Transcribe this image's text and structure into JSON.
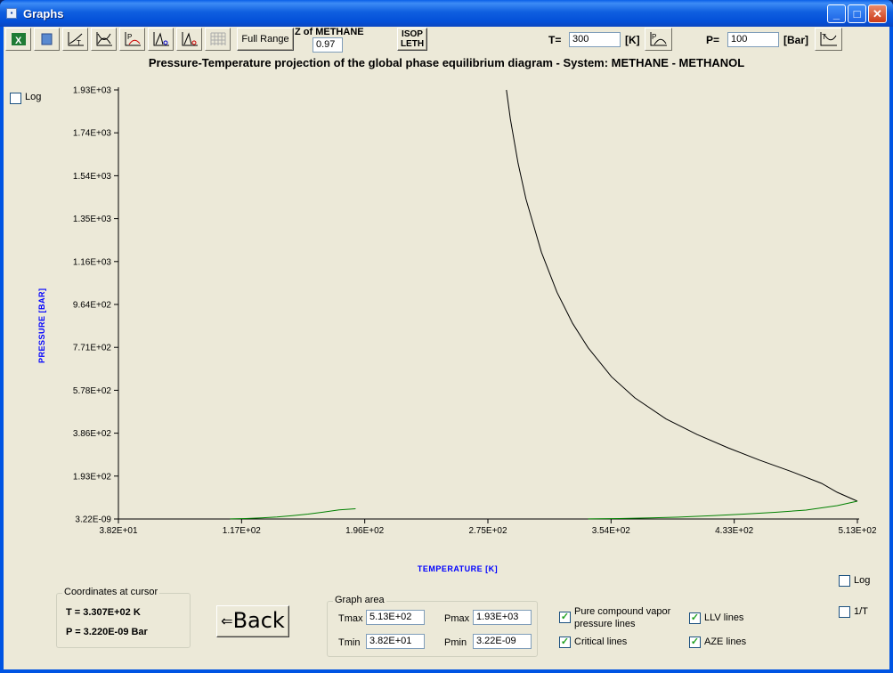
{
  "window": {
    "title": "Graphs"
  },
  "toolbar": {
    "full_range_label": "Full Range",
    "z_label": "Z of METHANE",
    "z_value": "0.97",
    "isopleth_label_1": "ISOP",
    "isopleth_label_2": "LETH",
    "t_label": "T=",
    "t_value": "300",
    "t_unit": "[K]",
    "p_label": "P=",
    "p_value": "100",
    "p_unit": "[Bar]"
  },
  "plot": {
    "title": "Pressure-Temperature projection of the global phase equilibrium diagram - System: METHANE - METHANOL",
    "log_y_label": "Log",
    "ylabel": "PRESSURE [BAR]",
    "xlabel": "TEMPERATURE [K]",
    "log_x_label": "Log",
    "inv_t_label": "1/T"
  },
  "chart_data": {
    "type": "line",
    "title": "Pressure-Temperature projection of the global phase equilibrium diagram - System: METHANE - METHANOL",
    "xlabel": "TEMPERATURE [K]",
    "ylabel": "PRESSURE [BAR]",
    "xlim": [
      38.2,
      513
    ],
    "ylim": [
      3.22e-09,
      1930
    ],
    "x_ticks": [
      "3.82E+01",
      "1.17E+02",
      "1.96E+02",
      "2.75E+02",
      "3.54E+02",
      "4.33E+02",
      "5.13E+02"
    ],
    "y_ticks": [
      "3.22E-09",
      "1.93E+02",
      "3.86E+02",
      "5.78E+02",
      "7.71E+02",
      "9.64E+02",
      "1.16E+03",
      "1.35E+03",
      "1.54E+03",
      "1.74E+03",
      "1.93E+03"
    ],
    "grid": false,
    "series": [
      {
        "color": "#000000",
        "x": [
          287.5,
          290,
          295,
          300,
          310,
          320,
          330,
          340,
          355,
          370,
          390,
          410,
          430,
          450,
          470,
          490,
          500,
          513
        ],
        "y": [
          1930,
          1800,
          1600,
          1440,
          1200,
          1020,
          880,
          770,
          640,
          545,
          450,
          380,
          320,
          265,
          215,
          160,
          120,
          80
        ]
      },
      {
        "color": "#008000",
        "x": [
          110,
          120,
          130,
          140,
          150,
          160,
          170,
          180,
          190.6
        ],
        "y": [
          0.5,
          2,
          5,
          9,
          15,
          22,
          31,
          41,
          46
        ]
      },
      {
        "color": "#008000",
        "x": [
          340,
          360,
          380,
          400,
          420,
          440,
          460,
          480,
          500,
          513
        ],
        "y": [
          0.5,
          2,
          5,
          9,
          15,
          22,
          30,
          40,
          60,
          80
        ]
      }
    ]
  },
  "cursor": {
    "group_title": "Coordinates at cursor",
    "t_text": "T = 3.307E+02 K",
    "p_text": "P = 3.220E-09 Bar"
  },
  "back_label": "Back",
  "graph_area": {
    "title": "Graph area",
    "tmax_label": "Tmax",
    "tmax": "5.13E+02",
    "tmin_label": "Tmin",
    "tmin": "3.82E+01",
    "pmax_label": "Pmax",
    "pmax": "1.93E+03",
    "pmin_label": "Pmin",
    "pmin": "3.22E-09"
  },
  "options": {
    "pure_vapor_1": "Pure compound vapor",
    "pure_vapor_2": "pressure lines",
    "critical": "Critical lines",
    "llv": "LLV lines",
    "aze": "AZE lines"
  }
}
